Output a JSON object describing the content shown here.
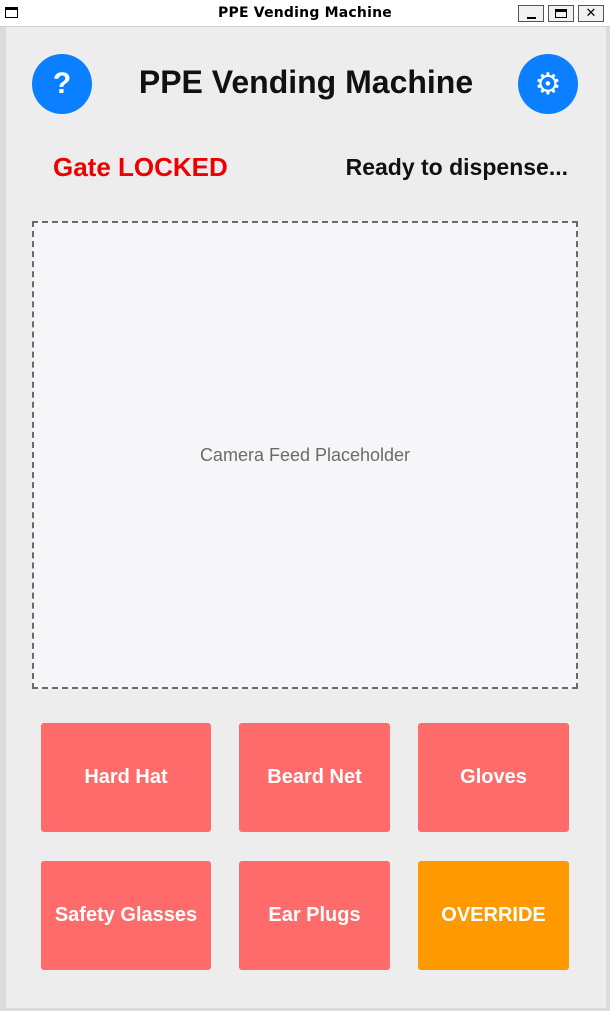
{
  "window": {
    "title": "PPE Vending Machine",
    "minimize_icon": "minimize-icon",
    "maximize_icon": "maximize-icon",
    "close_label": "✕"
  },
  "header": {
    "title": "PPE Vending Machine",
    "help_label": "?",
    "settings_label": "⚙"
  },
  "status": {
    "gate": "Gate LOCKED",
    "dispense": "Ready to dispense...",
    "gate_color": "#ee0000"
  },
  "camera": {
    "placeholder": "Camera Feed Placeholder"
  },
  "buttons": [
    {
      "label": "Hard Hat"
    },
    {
      "label": "Beard Net"
    },
    {
      "label": "Gloves"
    },
    {
      "label": "Safety Glasses"
    },
    {
      "label": "Ear Plugs"
    },
    {
      "label": "OVERRIDE"
    }
  ],
  "colors": {
    "accent": "#0a7fff",
    "item_button": "#ff6b6b",
    "override_button": "#ff9900"
  }
}
